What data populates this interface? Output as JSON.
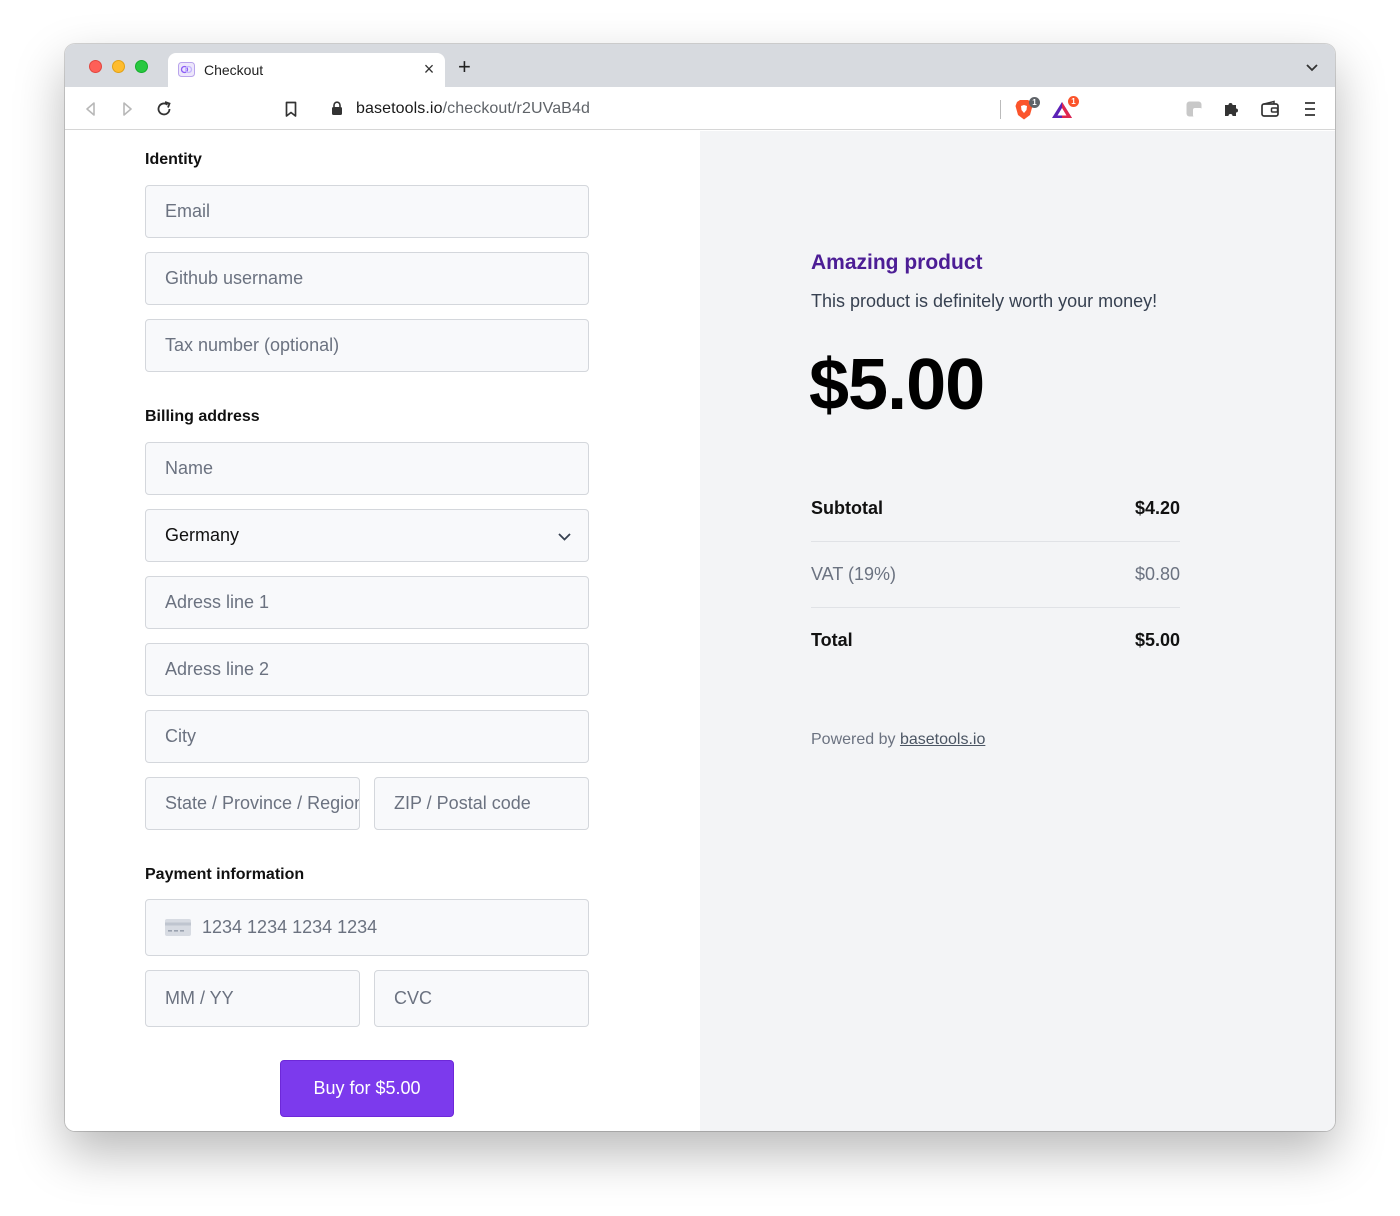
{
  "browser": {
    "tab_title": "Checkout",
    "tab_close": "×",
    "new_tab": "+",
    "url_host": "basetools.io",
    "url_path": "/checkout/r2UVaB4d",
    "extension_badges": [
      "1",
      "1"
    ]
  },
  "form": {
    "identity_title": "Identity",
    "email_placeholder": "Email",
    "github_placeholder": "Github username",
    "tax_placeholder": "Tax number (optional)",
    "billing_title": "Billing address",
    "name_placeholder": "Name",
    "country_value": "Germany",
    "address1_placeholder": "Adress line 1",
    "address2_placeholder": "Adress line 2",
    "city_placeholder": "City",
    "state_placeholder": "State / Province / Region",
    "zip_placeholder": "ZIP / Postal code",
    "payment_title": "Payment information",
    "card_placeholder": "1234 1234 1234 1234",
    "expiry_placeholder": "MM / YY",
    "cvc_placeholder": "CVC",
    "buy_label": "Buy for $5.00"
  },
  "summary": {
    "product_name": "Amazing product",
    "product_description": "This product is definitely worth your money!",
    "price": "$5.00",
    "subtotal_label": "Subtotal",
    "subtotal_value": "$4.20",
    "vat_label": "VAT (19%)",
    "vat_value": "$0.80",
    "total_label": "Total",
    "total_value": "$5.00",
    "powered_by": "Powered by",
    "powered_link": "basetools.io"
  },
  "colors": {
    "accent": "#7c3aed",
    "product_name": "#4c1d95",
    "summary_bg": "#f3f4f6"
  }
}
